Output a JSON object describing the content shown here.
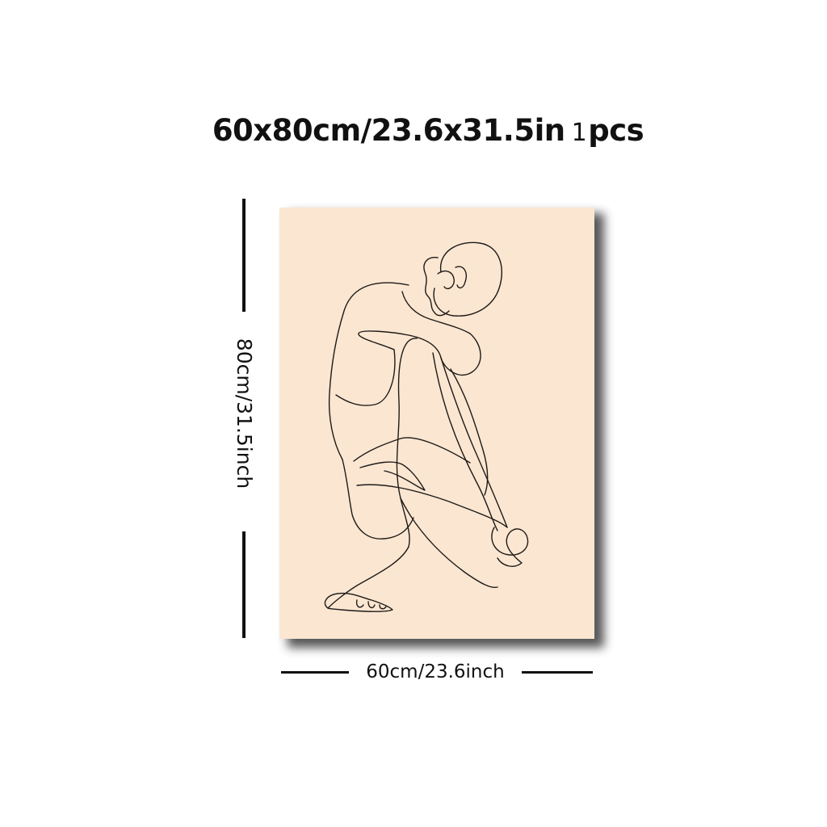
{
  "product": {
    "size_heading": "60x80cm/23.6x31.5in",
    "quantity_number": "1",
    "quantity_unit": "pcs"
  },
  "dimensions": {
    "height_label": "80cm/31.5inch",
    "width_label": "60cm/23.6inch"
  },
  "artwork": {
    "subject": "one-line drawing of a seated figure hugging knees",
    "background_color": "#fbe6d1",
    "line_color": "#1e1a17"
  }
}
